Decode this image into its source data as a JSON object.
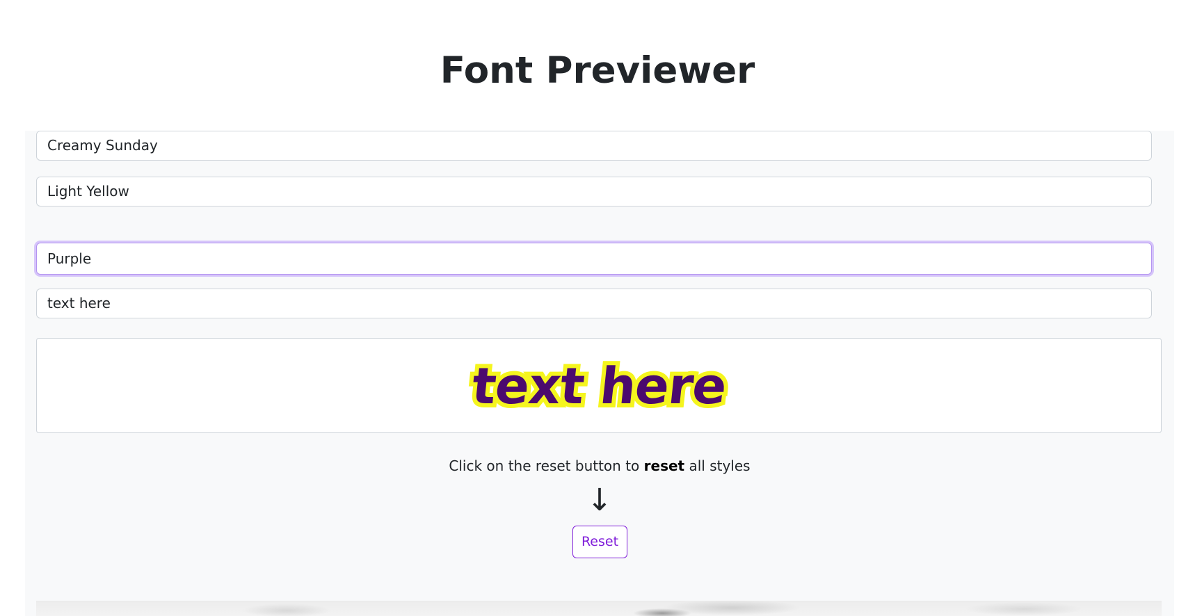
{
  "page": {
    "title": "Font Previewer"
  },
  "form": {
    "font_family_value": "Creamy Sunday",
    "outline_color_value": "Light Yellow",
    "text_color_value": "Purple",
    "preview_text_value": "text here"
  },
  "preview": {
    "text": "text here",
    "fill_color": "#4b0a6e",
    "outline_color": "#f5f51e"
  },
  "reset_section": {
    "hint_before": "Click on the reset button to ",
    "hint_bold": "reset",
    "hint_after": " all styles",
    "arrow": "↓",
    "button_label": "Reset"
  },
  "colors": {
    "accent": "#7f1cd9",
    "focus_ring": "#d6c5fa",
    "panel_bg": "#f8f9fa"
  }
}
